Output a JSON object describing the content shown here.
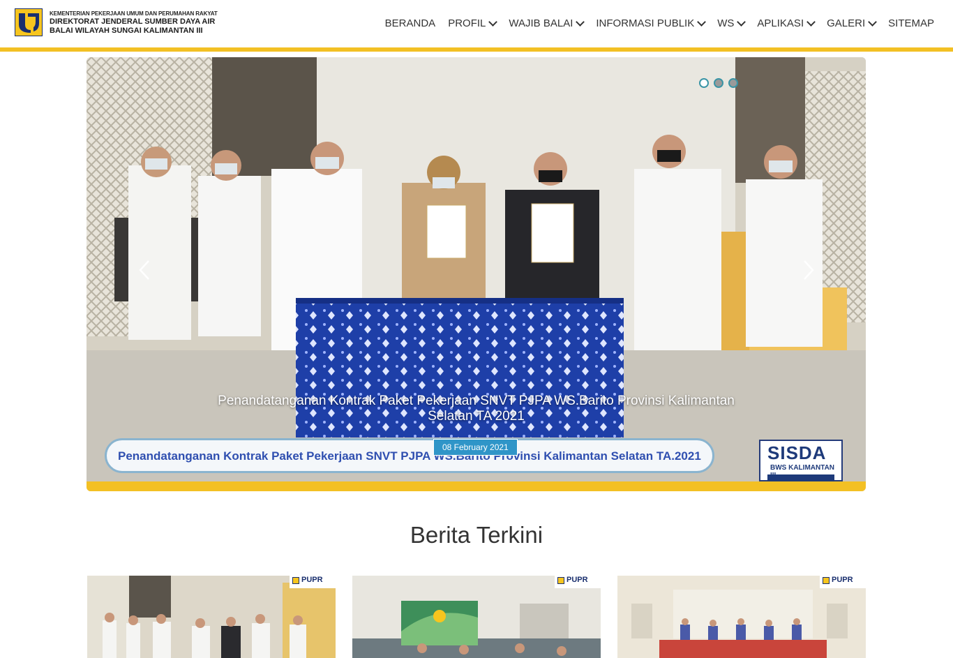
{
  "header": {
    "ministry": "KEMENTERIAN PEKERJAAN UMUM DAN PERUMAHAN RAKYAT",
    "directorate": "DIREKTORAT JENDERAL SUMBER DAYA AIR",
    "office": "BALAI WILAYAH SUNGAI KALIMANTAN III",
    "logo_icon": "pupr-logo-icon"
  },
  "nav": {
    "items": [
      {
        "label": "BERANDA",
        "dropdown": false
      },
      {
        "label": "PROFIL",
        "dropdown": true
      },
      {
        "label": "WAJIB BALAI",
        "dropdown": true
      },
      {
        "label": "INFORMASI PUBLIK",
        "dropdown": true
      },
      {
        "label": "WS",
        "dropdown": true
      },
      {
        "label": "APLIKASI",
        "dropdown": true
      },
      {
        "label": "GALERI",
        "dropdown": true
      },
      {
        "label": "SITEMAP",
        "dropdown": false
      }
    ]
  },
  "slider": {
    "caption": "Penandatanganan Kontrak Paket Pekerjaan SNVT PJPA WS.Barito Provinsi Kalimantan Selatan TA 2021",
    "date": "08 February 2021",
    "banner_text": "Penandatanganan Kontrak Paket Pekerjaan SNVT PJPA WS.Barito Provinsi Kalimantan Selatan TA.2021",
    "sisda_title": "SISDA",
    "sisda_subtitle": "BWS KALIMANTAN III",
    "dots": 3,
    "active_dot": 0
  },
  "news": {
    "title": "Berita Terkini",
    "badge_text": "PUPR",
    "cards": [
      {
        "image": "signing-group-photo"
      },
      {
        "image": "meeting-room-photo"
      },
      {
        "image": "hall-meeting-photo"
      }
    ]
  },
  "colors": {
    "accent": "#f3c024",
    "date_badge": "#2f95c8",
    "brand_blue": "#1a2f6e"
  }
}
